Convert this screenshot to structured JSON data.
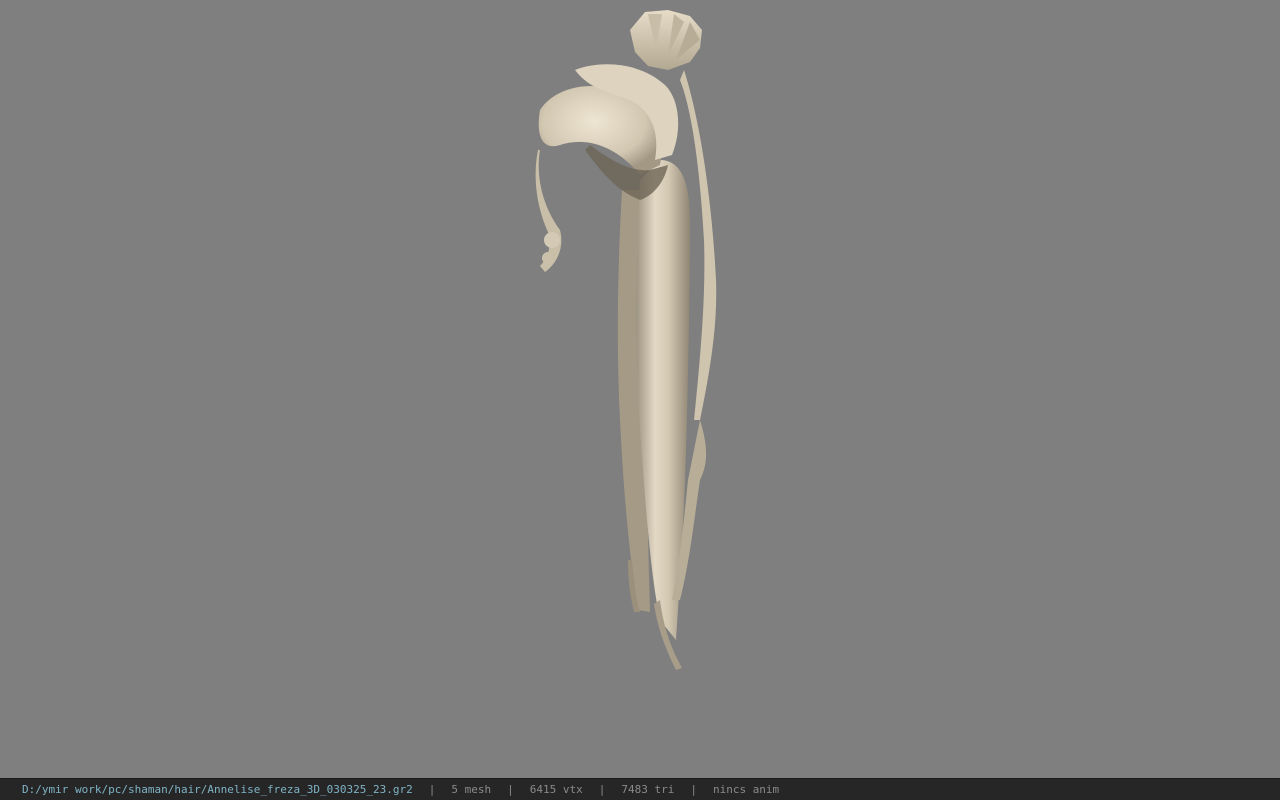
{
  "viewport": {
    "background_color": "#7f7f7f",
    "model_color": "#d8cdb8",
    "model_icon": "hair-mesh-render"
  },
  "status_bar": {
    "file_path": "D:/ymir work/pc/shaman/hair/Annelise_freza_3D_030325_23.gr2",
    "separator": "|",
    "mesh_count": "5 mesh",
    "vertex_count": "6415 vtx",
    "triangle_count": "7483 tri",
    "anim_status": "nincs anim",
    "path_color": "#7fb3c6",
    "text_color": "#8a8a8a"
  }
}
